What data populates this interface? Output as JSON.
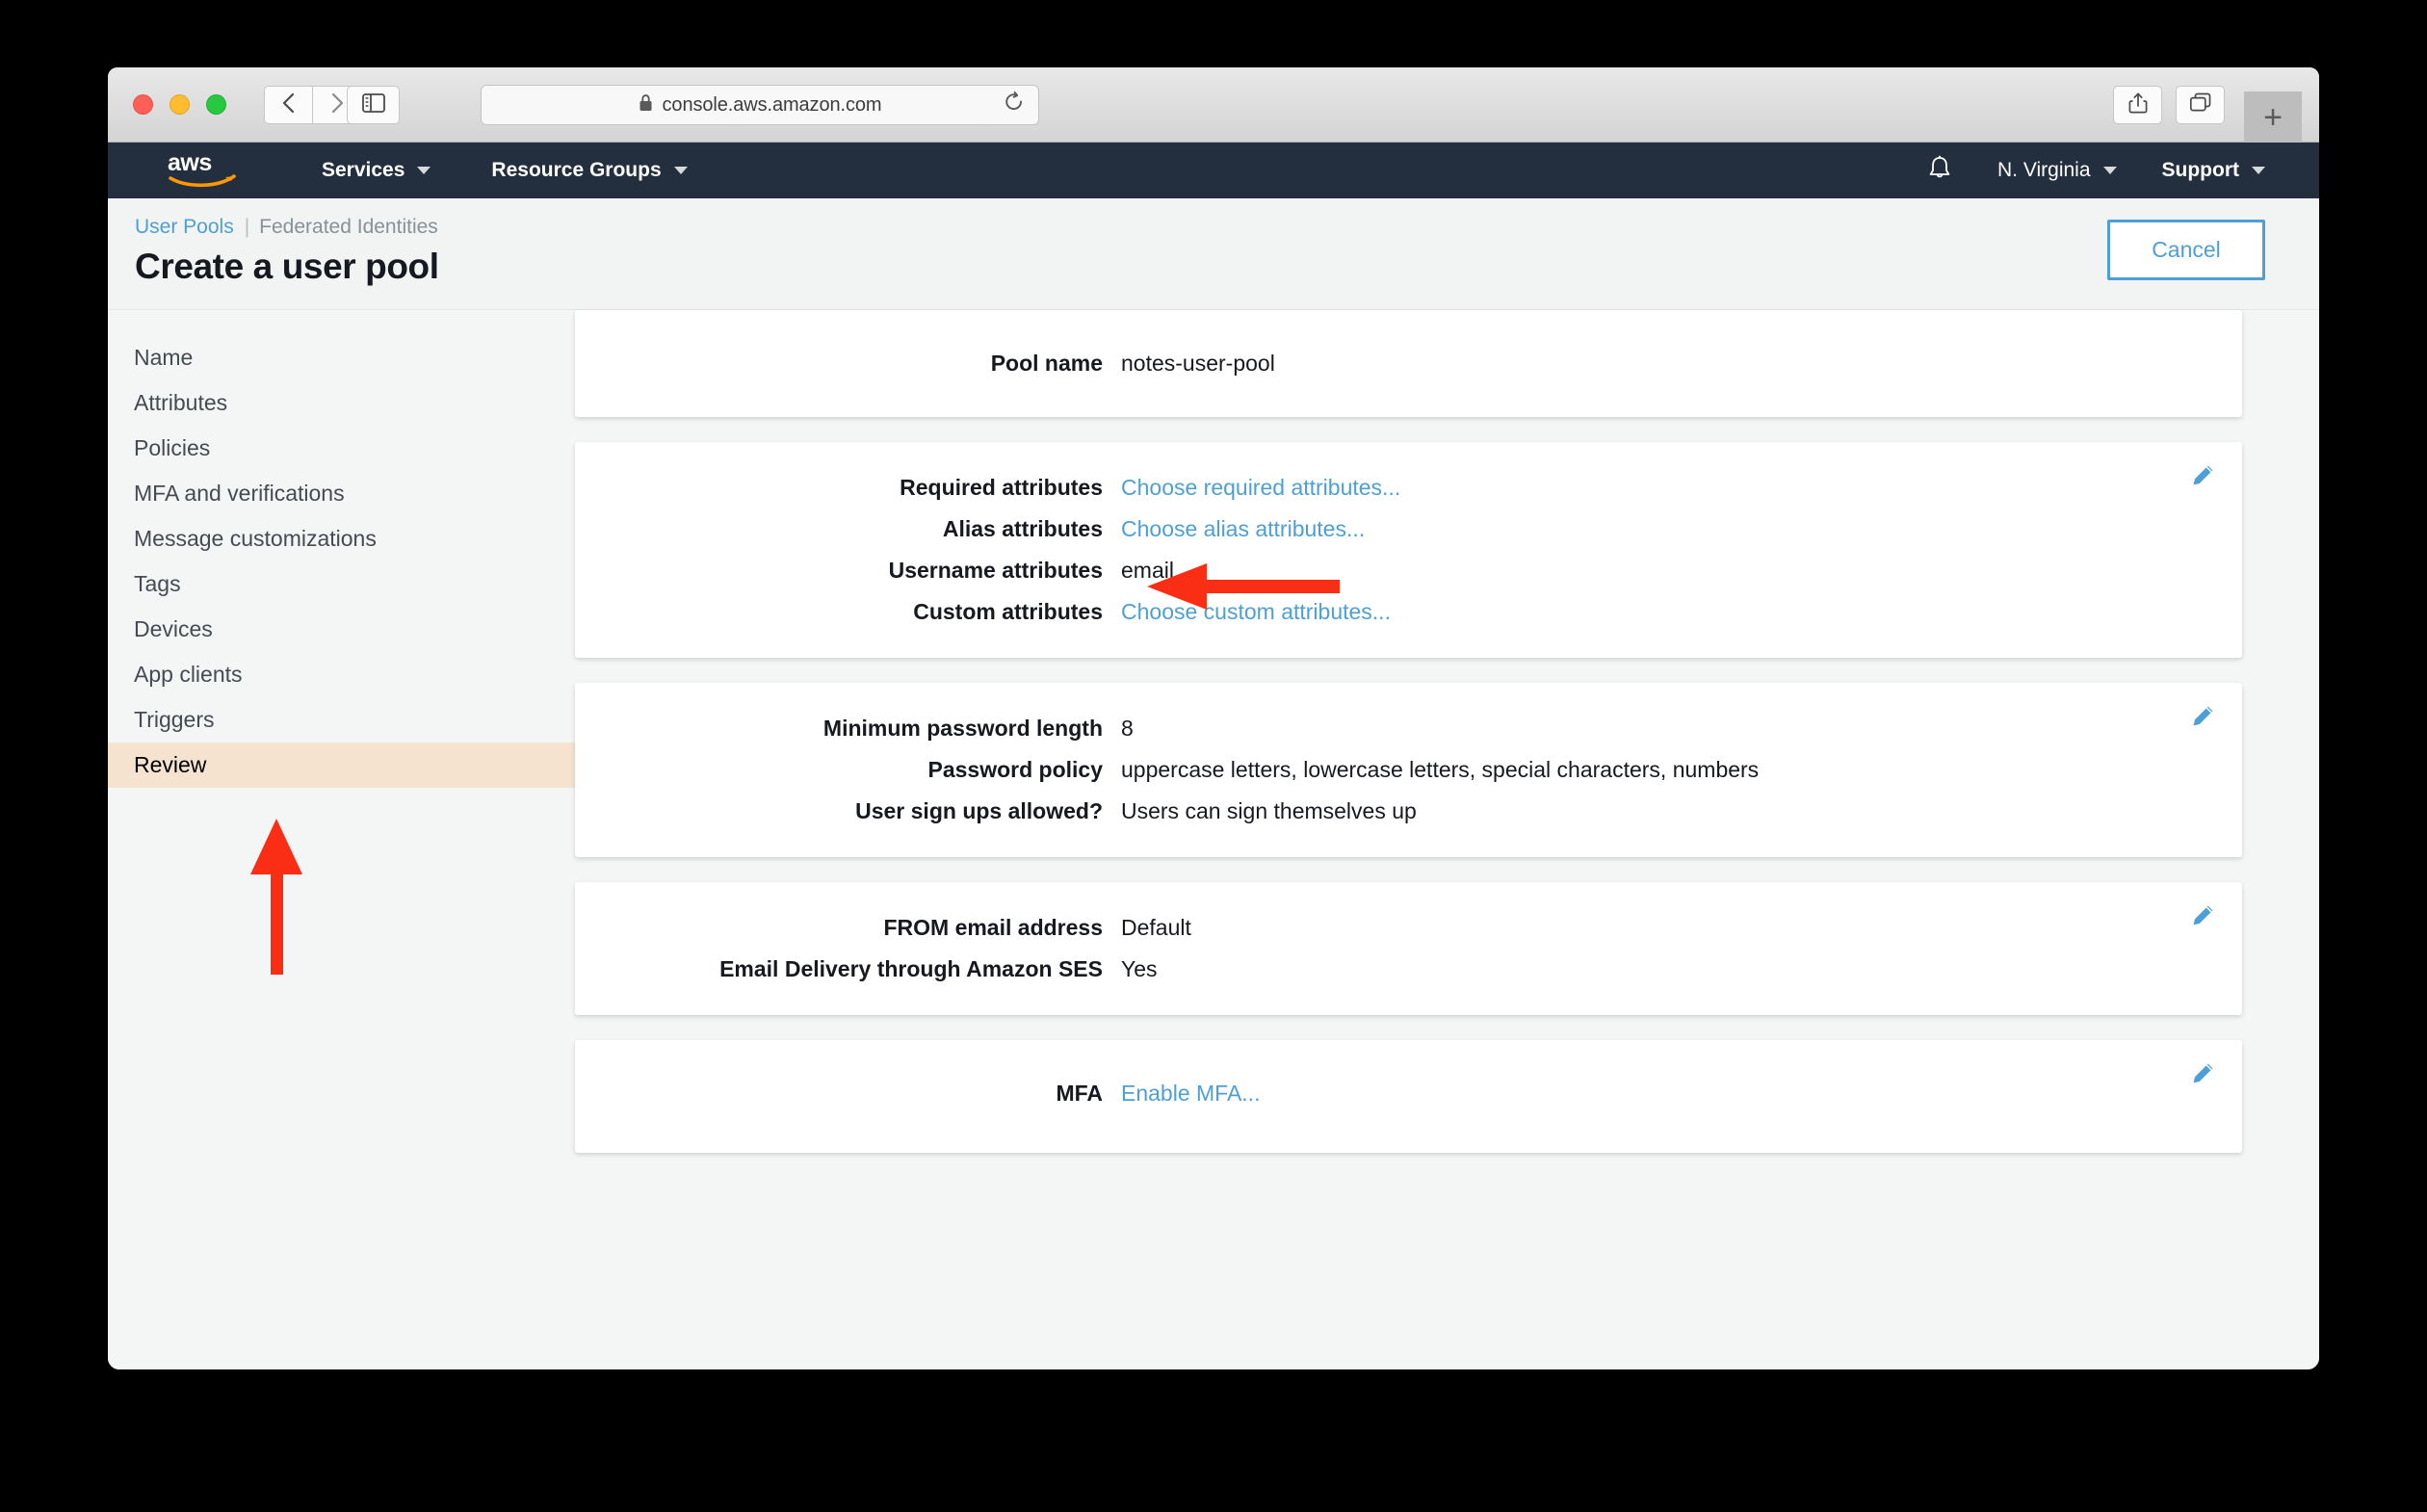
{
  "browser": {
    "url": "console.aws.amazon.com",
    "lock_icon": "lock-icon",
    "back_icon": "chevron-left-icon",
    "forward_icon": "chevron-right-icon",
    "sidebar_icon": "sidebar-toggle-icon",
    "reload_icon": "reload-icon",
    "share_icon": "share-icon",
    "tabs_icon": "show-tabs-icon",
    "new_tab_label": "+"
  },
  "aws_nav": {
    "logo": "aws-logo",
    "services_label": "Services",
    "resource_groups_label": "Resource Groups",
    "bell_icon": "notifications-bell-icon",
    "region_label": "N. Virginia",
    "support_label": "Support"
  },
  "header": {
    "breadcrumb_primary": "User Pools",
    "breadcrumb_separator": "|",
    "breadcrumb_secondary": "Federated Identities",
    "title": "Create a user pool",
    "cancel_label": "Cancel"
  },
  "sidebar": {
    "items": [
      {
        "label": "Name",
        "active": false
      },
      {
        "label": "Attributes",
        "active": false
      },
      {
        "label": "Policies",
        "active": false
      },
      {
        "label": "MFA and verifications",
        "active": false
      },
      {
        "label": "Message customizations",
        "active": false
      },
      {
        "label": "Tags",
        "active": false
      },
      {
        "label": "Devices",
        "active": false
      },
      {
        "label": "App clients",
        "active": false
      },
      {
        "label": "Triggers",
        "active": false
      },
      {
        "label": "Review",
        "active": true
      }
    ]
  },
  "cards": {
    "pool_name": {
      "label": "Pool name",
      "value": "notes-user-pool"
    },
    "attributes": {
      "required_label": "Required attributes",
      "required_value": "Choose required attributes...",
      "alias_label": "Alias attributes",
      "alias_value": "Choose alias attributes...",
      "username_label": "Username attributes",
      "username_value": "email",
      "custom_label": "Custom attributes",
      "custom_value": "Choose custom attributes...",
      "edit_icon": "edit-pencil-icon"
    },
    "policies": {
      "min_length_label": "Minimum password length",
      "min_length_value": "8",
      "policy_label": "Password policy",
      "policy_value": "uppercase letters, lowercase letters, special characters, numbers",
      "signup_label": "User sign ups allowed?",
      "signup_value": "Users can sign themselves up",
      "edit_icon": "edit-pencil-icon"
    },
    "email": {
      "from_label": "FROM email address",
      "from_value": "Default",
      "ses_label": "Email Delivery through Amazon SES",
      "ses_value": "Yes",
      "edit_icon": "edit-pencil-icon"
    },
    "mfa": {
      "mfa_label": "MFA",
      "mfa_value": "Enable MFA...",
      "edit_icon": "edit-pencil-icon"
    }
  },
  "annotations": {
    "arrow_up_icon": "red-arrow-up-annotation",
    "arrow_left_icon": "red-arrow-left-annotation"
  },
  "colors": {
    "aws_navy": "#232f3e",
    "aws_orange": "#ff9900",
    "link_blue": "#4d9fd6",
    "highlight_peach": "#f5e3d0",
    "annotation_red": "#f92e14",
    "page_bg": "#f4f5f5"
  }
}
